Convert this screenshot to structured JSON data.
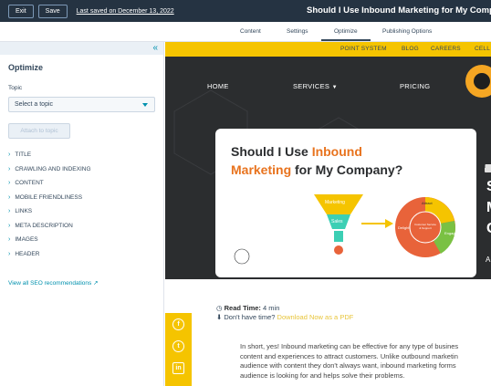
{
  "topbar": {
    "exit_label": "Exit",
    "save_label": "Save",
    "last_saved": "Last saved on December 13, 2022",
    "document_title": "Should I Use Inbound Marketing for My Compa"
  },
  "tabs": [
    {
      "label": "Content"
    },
    {
      "label": "Settings"
    },
    {
      "label": "Optimize",
      "active": true
    },
    {
      "label": "Publishing Options"
    }
  ],
  "sidebar": {
    "title": "Optimize",
    "topic_label": "Topic",
    "topic_placeholder": "Select a topic",
    "attach_label": "Attach to topic",
    "items": [
      {
        "label": "TITLE"
      },
      {
        "label": "CRAWLING AND INDEXING"
      },
      {
        "label": "CONTENT"
      },
      {
        "label": "MOBILE FRIENDLINESS"
      },
      {
        "label": "LINKS"
      },
      {
        "label": "META DESCRIPTION"
      },
      {
        "label": "IMAGES"
      },
      {
        "label": "HEADER"
      }
    ],
    "view_all": "View all SEO recommendations"
  },
  "preview": {
    "top_nav": [
      "POINT SYSTEM",
      "BLOG",
      "CAREERS",
      "CELL"
    ],
    "main_nav": [
      "HOME",
      "SERVICES",
      "PRICING"
    ],
    "hero": {
      "title_pre": "Should I Use ",
      "title_hl": "Inbound Marketing",
      "title_post": " for My Company?",
      "funnel_top": "Marketing",
      "funnel_mid": "Sales",
      "wheel_center": "Customer Service & Support",
      "wheel_labels": [
        "Attract",
        "Engage",
        "Delight"
      ]
    },
    "peek": {
      "tag": "I",
      "letters": [
        "S",
        "M",
        "C"
      ],
      "a": "A"
    },
    "read_time_label": "Read Time:",
    "read_time_value": "4 min",
    "dont_have_time": "Don't have time?",
    "download_link": "Download Now as a PDF",
    "body_lines": [
      "In short, yes! Inbound marketing can be effective for any type of busines",
      "content and experiences to attract customers. Unlike outbound marketin",
      "audience with content they don't always want, inbound marketing forms",
      "audience is looking for and helps solve their problems."
    ],
    "colors": {
      "accent_yellow": "#f5c400",
      "highlight_orange": "#e8731e",
      "link_teal": "#0091ae"
    }
  }
}
